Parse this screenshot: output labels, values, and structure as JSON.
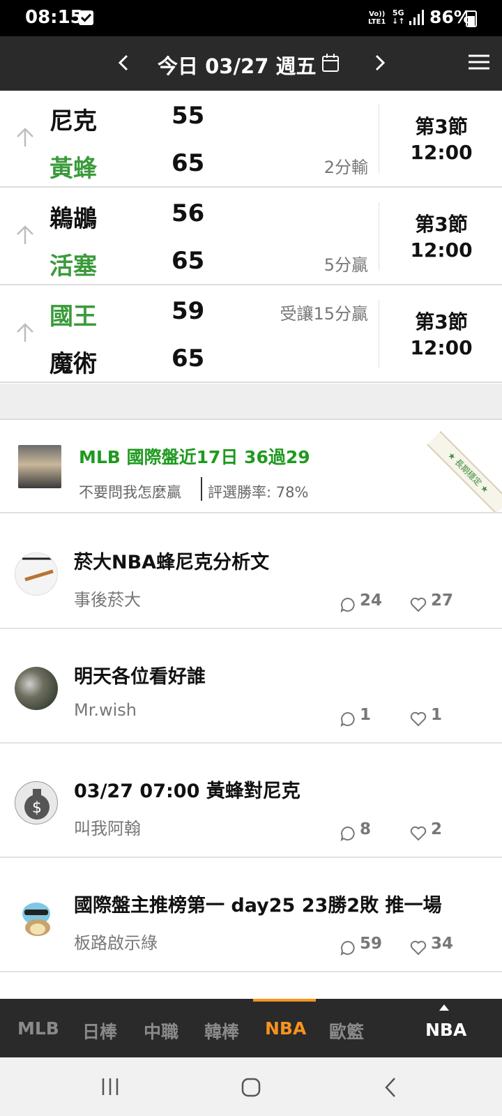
{
  "status_bar": {
    "time": "08:15",
    "volte": "Vo))\nLTE1",
    "network": "5G",
    "battery": "86%"
  },
  "header": {
    "title": "今日 03/27 週五"
  },
  "games": [
    {
      "team1": "尼克",
      "score1": "55",
      "team1_color": "#111111",
      "team2": "黃蜂",
      "score2": "65",
      "team2_color": "#3a9a3a",
      "note": "2分輸",
      "note_row": 2,
      "period": "第3節",
      "clock": "12:00"
    },
    {
      "team1": "鵜鶘",
      "score1": "56",
      "team1_color": "#111111",
      "team2": "活塞",
      "score2": "65",
      "team2_color": "#3a9a3a",
      "note": "5分贏",
      "note_row": 2,
      "period": "第3節",
      "clock": "12:00"
    },
    {
      "team1": "國王",
      "score1": "59",
      "team1_color": "#3a9a3a",
      "team2": "魔術",
      "score2": "65",
      "team2_color": "#111111",
      "note": "受讓15分贏",
      "note_row": 1,
      "period": "第3節",
      "clock": "12:00"
    }
  ],
  "promo": {
    "title": "MLB 國際盤近17日 36過29",
    "subtitle": "不要問我怎麼贏",
    "rate": "評選勝率: 78%",
    "ribbon": "★ 長期穩定 ★"
  },
  "posts": [
    {
      "title": "菸大NBA蜂尼克分析文",
      "author": "事後菸大",
      "comments": "24",
      "likes": "27",
      "avatar": "cigarette"
    },
    {
      "title": "明天各位看好誰",
      "author": "Mr.wish",
      "comments": "1",
      "likes": "1",
      "avatar": "night-photo"
    },
    {
      "title": "03/27 07:00 黃蜂對尼克",
      "author": "叫我阿翰",
      "comments": "8",
      "likes": "2",
      "avatar": "money-bag"
    },
    {
      "title": "國際盤主推榜第一 day25 23勝2敗 推一場",
      "author": "板路啟示綠",
      "comments": "59",
      "likes": "34",
      "avatar": "squirtle"
    }
  ],
  "league_tabs": {
    "items": [
      "MLB",
      "日棒",
      "中職",
      "韓棒",
      "NBA",
      "歐籃"
    ],
    "active_index": 4,
    "current": "NBA"
  },
  "colors": {
    "accent": "#f7931e",
    "win_green": "#3a9a3a",
    "promo_green": "#1f9a1f",
    "header_bg": "#2a2a2a"
  }
}
